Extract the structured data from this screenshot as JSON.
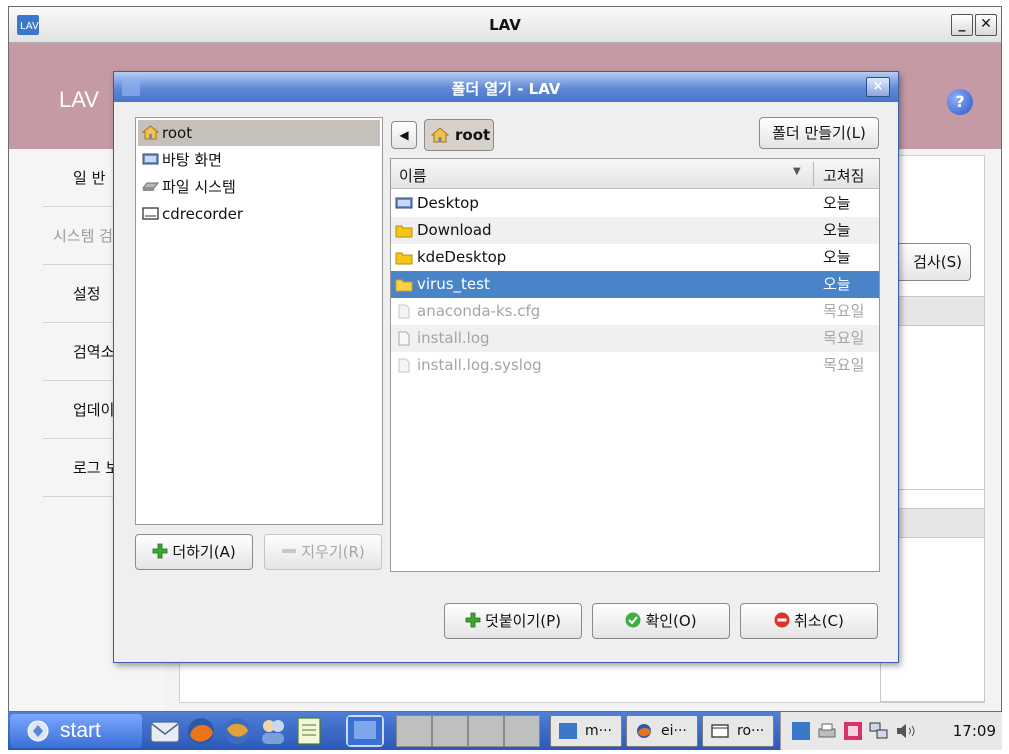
{
  "outer_window": {
    "title": "LAV",
    "minimize_label": "_",
    "close_label": "✕"
  },
  "app": {
    "header_title": "LAV",
    "help_label": "?",
    "sidebar": [
      {
        "label": "일 반"
      },
      {
        "label": "시스템 검"
      },
      {
        "label": "설정"
      },
      {
        "label": "검역소"
      },
      {
        "label": "업데이트"
      },
      {
        "label": "로그 보"
      }
    ],
    "scan_button": "검사(S)"
  },
  "dialog": {
    "title": "폴더 열기 - LAV",
    "close_label": "×",
    "places": [
      {
        "label": "root",
        "icon": "home-folder-icon",
        "selected": true
      },
      {
        "label": "바탕 화면",
        "icon": "desktop-icon",
        "selected": false
      },
      {
        "label": "파일 시스템",
        "icon": "drive-icon",
        "selected": false
      },
      {
        "label": "cdrecorder",
        "icon": "cd-drive-icon",
        "selected": false
      }
    ],
    "path_back": "◀",
    "path_current": "root",
    "make_folder_button": "폴더 만들기(L)",
    "columns": {
      "name": "이름",
      "modified": "고쳐짐"
    },
    "files": [
      {
        "name": "Desktop",
        "modified": "오늘",
        "icon": "desktop-icon",
        "state": "normal"
      },
      {
        "name": "Download",
        "modified": "오늘",
        "icon": "folder-icon",
        "state": "alt"
      },
      {
        "name": "kdeDesktop",
        "modified": "오늘",
        "icon": "folder-icon",
        "state": "normal"
      },
      {
        "name": "virus_test",
        "modified": "오늘",
        "icon": "folder-icon",
        "state": "selected"
      },
      {
        "name": "anaconda-ks.cfg",
        "modified": "목요일",
        "icon": "file-icon",
        "state": "dim"
      },
      {
        "name": "install.log",
        "modified": "목요일",
        "icon": "file-icon",
        "state": "dim-alt"
      },
      {
        "name": "install.log.syslog",
        "modified": "목요일",
        "icon": "file-icon",
        "state": "dim"
      }
    ],
    "add_button": "더하기(A)",
    "remove_button": "지우기(R)",
    "attach_button": "덧붙이기(P)",
    "ok_button": "확인(O)",
    "cancel_button": "취소(C)"
  },
  "taskbar": {
    "start_label": "start",
    "tasks": [
      {
        "label": "m···"
      },
      {
        "label": "ei···"
      },
      {
        "label": "ro···"
      }
    ],
    "clock": "17:09"
  },
  "colors": {
    "app_header": "#c59aa4",
    "dialog_title": "#4a74c8",
    "selection": "#4a84c8",
    "taskbar": "#2b59b8"
  }
}
